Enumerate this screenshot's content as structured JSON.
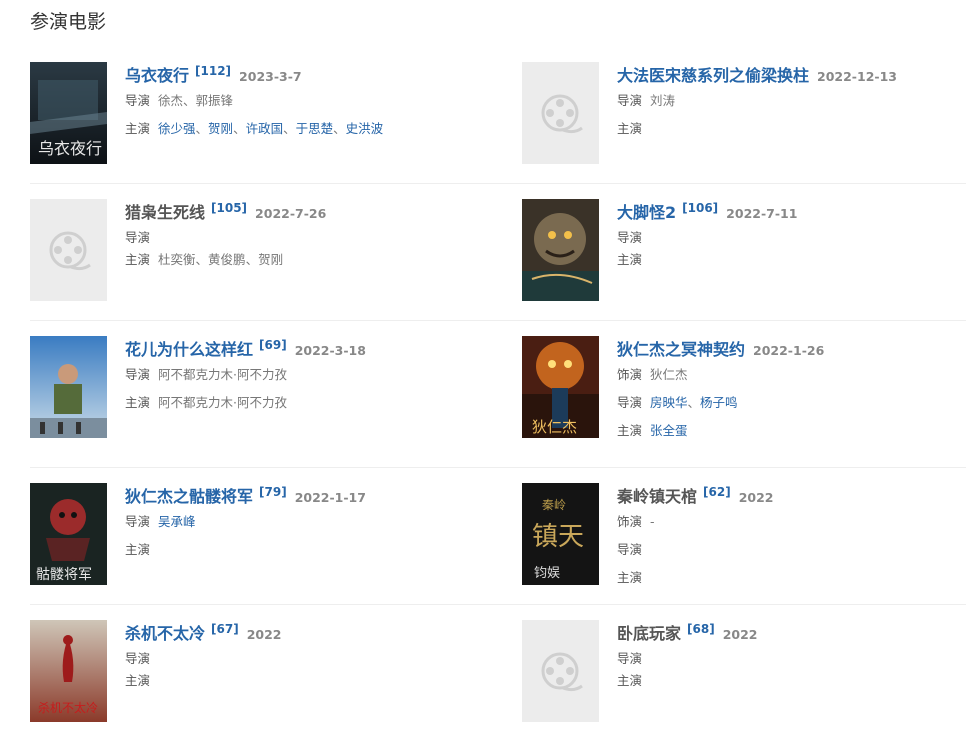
{
  "section_title": "参演电影",
  "colors": {
    "link": "#2665a8",
    "muted": "#888888",
    "divider": "#eeeeee"
  },
  "movies": [
    {
      "title": "乌衣夜行",
      "count": "[112]",
      "date": "2023-3-7",
      "title_link": true,
      "poster": "poster-dark-city",
      "roles": [
        {
          "label": "导演",
          "link": false,
          "people": [
            "徐杰",
            "郭振锋"
          ]
        },
        {
          "label": "主演",
          "link": true,
          "people": [
            "徐少强",
            "贺刚",
            "许政国",
            "于思楚",
            "史洪波"
          ]
        }
      ]
    },
    {
      "title": "大法医宋慈系列之偷梁换柱",
      "count": "",
      "date": "2022-12-13",
      "title_link": true,
      "poster": "placeholder-film-icon",
      "roles": [
        {
          "label": "导演",
          "link": false,
          "people": [
            "刘涛"
          ]
        },
        {
          "label": "主演",
          "link": false,
          "people": []
        }
      ]
    },
    {
      "title": "猎枭生死线",
      "count": "[105]",
      "date": "2022-7-26",
      "title_link": false,
      "poster": "placeholder-film-icon",
      "roles": [
        {
          "label": "导演",
          "link": false,
          "people": []
        },
        {
          "label": "主演",
          "link": false,
          "people": [
            "杜奕衡",
            "黄俊鹏",
            "贺刚"
          ]
        }
      ]
    },
    {
      "title": "大脚怪2",
      "count": "[106]",
      "date": "2022-7-11",
      "title_link": true,
      "poster": "poster-bigfoot",
      "roles": [
        {
          "label": "导演",
          "link": false,
          "people": []
        },
        {
          "label": "主演",
          "link": false,
          "people": []
        }
      ]
    },
    {
      "title": "花儿为什么这样红",
      "count": "[69]",
      "date": "2022-3-18",
      "title_link": true,
      "poster": "poster-sky",
      "roles": [
        {
          "label": "导演",
          "link": false,
          "people": [
            "阿不都克力木·阿不力孜"
          ]
        },
        {
          "label": "主演",
          "link": false,
          "people": [
            "阿不都克力木·阿不力孜"
          ]
        }
      ]
    },
    {
      "title": "狄仁杰之冥神契约",
      "count": "",
      "date": "2022-1-26",
      "title_link": true,
      "poster": "poster-dragon",
      "roles": [
        {
          "label": "饰演",
          "link": false,
          "people": [
            "狄仁杰"
          ]
        },
        {
          "label": "导演",
          "link": true,
          "people": [
            "房映华",
            "杨子鸣"
          ]
        },
        {
          "label": "主演",
          "link": true,
          "people": [
            "张全蛋"
          ]
        }
      ]
    },
    {
      "title": "狄仁杰之骷髅将军",
      "count": "[79]",
      "date": "2022-1-17",
      "title_link": true,
      "poster": "poster-skeleton",
      "roles": [
        {
          "label": "导演",
          "link": true,
          "people": [
            "吴承峰"
          ]
        },
        {
          "label": "主演",
          "link": false,
          "people": []
        }
      ]
    },
    {
      "title": "秦岭镇天棺",
      "count": "[62]",
      "date": "2022",
      "title_link": false,
      "poster": "poster-coffin",
      "roles": [
        {
          "label": "饰演",
          "link": false,
          "people": [
            "-"
          ]
        },
        {
          "label": "导演",
          "link": false,
          "people": []
        },
        {
          "label": "主演",
          "link": false,
          "people": []
        }
      ]
    },
    {
      "title": "杀机不太冷",
      "count": "[67]",
      "date": "2022",
      "title_link": true,
      "poster": "poster-red",
      "roles": [
        {
          "label": "导演",
          "link": false,
          "people": []
        },
        {
          "label": "主演",
          "link": false,
          "people": []
        }
      ]
    },
    {
      "title": "卧底玩家",
      "count": "[68]",
      "date": "2022",
      "title_link": false,
      "poster": "placeholder-film-icon",
      "roles": [
        {
          "label": "导演",
          "link": false,
          "people": []
        },
        {
          "label": "主演",
          "link": false,
          "people": []
        }
      ]
    }
  ]
}
